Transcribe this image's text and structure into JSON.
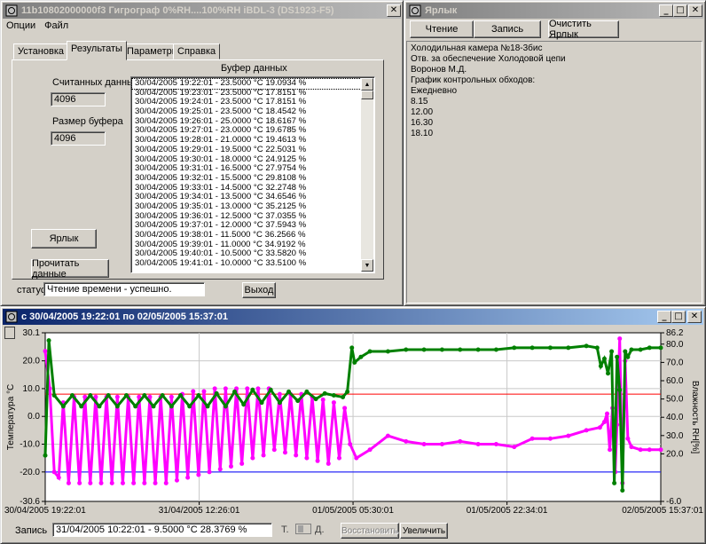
{
  "main_window": {
    "title": "11b10802000000f3    Гигрограф 0%RH....100%RH    iBDL-3 (DS1923-F5)",
    "menu": [
      "Опции",
      "Файл"
    ],
    "tabs": [
      "Установка",
      "Результаты",
      "Параметры",
      "Справка"
    ],
    "active_tab": "Результаты",
    "read_count_label": "Считанных данных",
    "read_count_value": "4096",
    "buffer_size_label": "Размер буфера",
    "buffer_size_value": "4096",
    "buffer_header": "Буфер данных",
    "label_button": "Ярлык",
    "read_button": "Прочитать данные",
    "status_label": "статус",
    "status_value": "Чтение времени - успешно.",
    "exit_button": "Выход",
    "buffer_rows": [
      "30/04/2005 19:22:01 -  23.5000 °C  19.0934 %",
      "30/04/2005 19:23:01 -  23.5000 °C  17.8151 %",
      "30/04/2005 19:24:01 -  23.5000 °C  17.8151 %",
      "30/04/2005 19:25:01 -  23.5000 °C  18.4542 %",
      "30/04/2005 19:26:01 -  25.0000 °C  18.6167 %",
      "30/04/2005 19:27:01 -  23.0000 °C  19.6785 %",
      "30/04/2005 19:28:01 -  21.0000 °C  19.4613 %",
      "30/04/2005 19:29:01 -  19.5000 °C  22.5031 %",
      "30/04/2005 19:30:01 -  18.0000 °C  24.9125 %",
      "30/04/2005 19:31:01 -  16.5000 °C  27.9754 %",
      "30/04/2005 19:32:01 -  15.5000 °C  29.8108 %",
      "30/04/2005 19:33:01 -  14.5000 °C  32.2748 %",
      "30/04/2005 19:34:01 -  13.5000 °C  34.6546 %",
      "30/04/2005 19:35:01 -  13.0000 °C  35.2125 %",
      "30/04/2005 19:36:01 -  12.5000 °C  37.0355 %",
      "30/04/2005 19:37:01 -  12.0000 °C  37.5943 %",
      "30/04/2005 19:38:01 -  11.5000 °C  36.2566 %",
      "30/04/2005 19:39:01 -  11.0000 °C  34.9192 %",
      "30/04/2005 19:40:01 -  10.5000 °C  33.5820 %",
      "30/04/2005 19:41:01 -  10.0000 °C  33.5100 %"
    ]
  },
  "label_window": {
    "title": "Ярлык",
    "read_button": "Чтение",
    "write_button": "Запись",
    "clear_button": "Очистить Ярлык",
    "memo_lines": [
      "Холодильная камера №18-3бис",
      "Отв. за обеспечение Холодовой цепи",
      "Воронов М.Д.",
      "График контрольных обходов:",
      "Ежедневно",
      "8.15",
      "12.00",
      "16.30",
      "18.10"
    ]
  },
  "chart_window": {
    "title": "с 30/04/2005 19:22:01 по 02/05/2005 15:37:01",
    "record_label": "Запись",
    "record_value": "31/04/2005 10:22:01 -  9.5000 °C  28.3769 %",
    "toggle_t": "Т.",
    "toggle_d": "Д.",
    "restore_button": "Восстановить",
    "zoom_button": "Увеличить"
  },
  "chart_data": {
    "type": "line",
    "xlabel": "",
    "ylabel_left": "Температура °C",
    "ylabel_right": "Влажность RH[%]",
    "ylim_left": [
      -30.6,
      30.1
    ],
    "ylim_right": [
      -6.0,
      86.2
    ],
    "yticks_left": [
      "30.1",
      "20.0",
      "10.0",
      "0.0",
      "-10.0",
      "-20.0",
      "-30.6"
    ],
    "yticks_right": [
      "86.2",
      "80.0",
      "70.0",
      "60.0",
      "50.0",
      "40.0",
      "30.0",
      "20.0",
      "-6.0"
    ],
    "xticks": [
      "30/04/2005 19:22:01",
      "31/04/2005 12:26:01",
      "01/05/2005 05:30:01",
      "01/05/2005 22:34:01",
      "02/05/2005 15:37:01"
    ],
    "x_hours": [
      0,
      17.07,
      34.13,
      51.2,
      68.25
    ],
    "threshold_high_temp": 8.0,
    "threshold_low_temp": -20.0,
    "colors": {
      "temperature": "#ff00ff",
      "humidity": "#008000",
      "threshold_high": "#ff0000",
      "threshold_low": "#0000ff",
      "plot_bg": "#ffffff"
    },
    "series": [
      {
        "name": "Температура",
        "axis": "left",
        "x_hours": [
          0,
          0.5,
          1.0,
          1.5,
          2.0,
          2.6,
          3.2,
          3.8,
          4.4,
          5.0,
          5.6,
          6.2,
          6.8,
          7.4,
          8.0,
          8.6,
          9.2,
          9.8,
          10.4,
          11.0,
          11.6,
          12.2,
          12.8,
          13.4,
          14.0,
          14.6,
          15.2,
          15.8,
          16.4,
          17.0,
          17.6,
          18.2,
          18.8,
          19.4,
          20.0,
          20.6,
          21.2,
          21.8,
          22.4,
          23.0,
          23.6,
          24.2,
          24.8,
          25.4,
          26.0,
          26.6,
          27.2,
          27.8,
          28.4,
          29.0,
          29.6,
          30.2,
          30.8,
          31.4,
          32.0,
          32.6,
          33.2,
          33.8,
          34.5,
          36,
          38,
          40,
          42,
          44,
          46,
          48,
          50,
          52,
          54,
          56,
          58,
          60,
          61.5,
          62.0,
          62.3,
          62.6,
          62.9,
          63.2,
          63.4,
          63.7,
          64.0,
          64.3,
          64.6,
          65,
          66,
          67,
          68.25
        ],
        "values": [
          23.5,
          10.0,
          -20.0,
          -22,
          5,
          -24,
          7,
          -24,
          7,
          -24,
          7,
          -24,
          7,
          -24,
          7,
          -24,
          7,
          -24,
          7,
          -24,
          7,
          -24,
          7,
          -24,
          7,
          -23,
          8,
          -22,
          9,
          -21,
          9,
          -20,
          10,
          -19,
          10,
          -18,
          10,
          -17,
          10,
          -15,
          10,
          -14,
          10,
          -12,
          8,
          -13,
          8,
          -14,
          8,
          -15,
          7,
          -16,
          6,
          -17,
          5,
          -15,
          3,
          -10,
          -15,
          -12,
          -7,
          -9,
          -10,
          -10,
          -9,
          -10,
          -10,
          -11,
          -8,
          -8,
          -7,
          -5,
          -4,
          -2,
          1,
          -12,
          3,
          -20,
          -3,
          28,
          -24,
          20,
          -8,
          -11,
          -12,
          -12,
          -12
        ]
      },
      {
        "name": "Влажность",
        "axis": "right",
        "x_hours": [
          0,
          0.4,
          1.0,
          2.0,
          3.0,
          4.0,
          5.0,
          6.0,
          7.0,
          8.0,
          9.0,
          10.0,
          11.0,
          12.0,
          13.0,
          14.0,
          15.0,
          16.0,
          17.0,
          18.0,
          19.0,
          20.0,
          21.0,
          22.0,
          23.0,
          24.0,
          25.0,
          26.0,
          27.0,
          28.0,
          29.0,
          30.0,
          31.0,
          32.0,
          33.0,
          33.5,
          34.0,
          34.3,
          35,
          36,
          38,
          40,
          42,
          44,
          46,
          48,
          50,
          52,
          54,
          56,
          58,
          60,
          61.2,
          61.6,
          62.0,
          62.4,
          62.8,
          63.1,
          63.4,
          63.7,
          64.0,
          64.3,
          64.6,
          65,
          66,
          67,
          68.25
        ],
        "values": [
          19.1,
          82,
          52,
          46,
          52,
          46,
          52,
          46,
          52,
          46,
          52,
          46,
          52,
          46,
          52,
          46,
          52,
          46,
          52,
          46,
          53,
          46,
          54,
          47,
          55,
          48,
          55,
          48,
          54,
          49,
          54,
          50,
          53,
          52,
          51,
          54,
          78,
          70,
          73,
          76,
          76,
          77,
          77,
          77,
          77,
          77,
          77,
          78,
          78,
          78,
          78,
          79,
          78,
          68,
          72,
          64,
          76,
          4,
          73,
          55,
          0,
          76,
          73,
          77,
          77,
          78,
          78
        ]
      }
    ]
  }
}
